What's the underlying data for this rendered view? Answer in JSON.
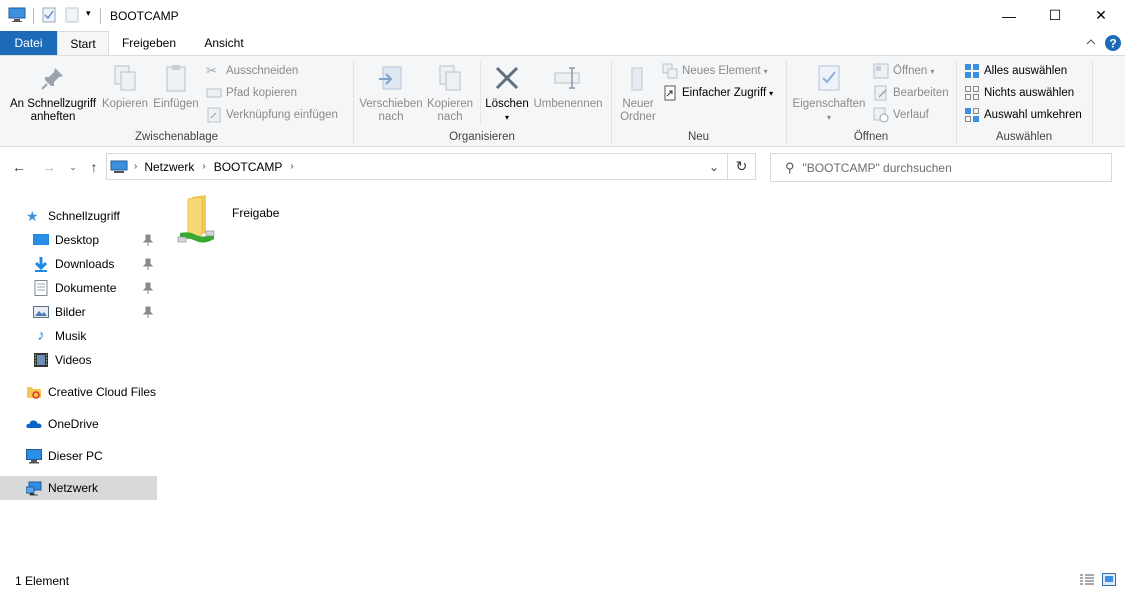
{
  "window": {
    "title": "BOOTCAMP",
    "minimize_glyph": "—",
    "maximize_glyph": "☐",
    "close_glyph": "✕"
  },
  "tabs": [
    {
      "label": "Datei"
    },
    {
      "label": "Start"
    },
    {
      "label": "Freigeben"
    },
    {
      "label": "Ansicht"
    }
  ],
  "ribbon": {
    "clipboard": {
      "label": "Zwischenablage",
      "pin_quick_line1": "An Schnellzugriff",
      "pin_quick_line2": "anheften",
      "copy": "Kopieren",
      "paste": "Einfügen",
      "cut": "Ausschneiden",
      "copy_path": "Pfad kopieren",
      "paste_shortcut": "Verknüpfung einfügen"
    },
    "organize": {
      "label": "Organisieren",
      "move_line1": "Verschieben",
      "move_line2": "nach",
      "copy_line1": "Kopieren",
      "copy_line2": "nach",
      "delete": "Löschen",
      "rename": "Umbenennen"
    },
    "new": {
      "label": "Neu",
      "new_folder_line1": "Neuer",
      "new_folder_line2": "Ordner",
      "new_item": "Neues Element",
      "easy_access": "Einfacher Zugriff"
    },
    "open": {
      "label": "Öffnen",
      "properties": "Eigenschaften",
      "open": "Öffnen",
      "edit": "Bearbeiten",
      "history": "Verlauf"
    },
    "select": {
      "label": "Auswählen",
      "select_all": "Alles auswählen",
      "select_none": "Nichts auswählen",
      "invert": "Auswahl umkehren"
    }
  },
  "address": {
    "crumbs": [
      "Netzwerk",
      "BOOTCAMP"
    ],
    "search_placeholder": "\"BOOTCAMP\" durchsuchen"
  },
  "nav": {
    "quick_access": "Schnellzugriff",
    "items": [
      {
        "label": "Desktop",
        "icon": "desktop-icon",
        "pinned": true
      },
      {
        "label": "Downloads",
        "icon": "downloads-icon",
        "pinned": true
      },
      {
        "label": "Dokumente",
        "icon": "documents-icon",
        "pinned": true
      },
      {
        "label": "Bilder",
        "icon": "pictures-icon",
        "pinned": true
      },
      {
        "label": "Musik",
        "icon": "music-icon",
        "pinned": false
      },
      {
        "label": "Videos",
        "icon": "videos-icon",
        "pinned": false
      }
    ],
    "creative_cloud": "Creative Cloud Files",
    "onedrive": "OneDrive",
    "this_pc": "Dieser PC",
    "network": "Netzwerk"
  },
  "content": {
    "items": [
      {
        "name": "Freigabe",
        "icon": "shared-folder-icon"
      }
    ]
  },
  "status": {
    "count": "1 Element"
  },
  "colors": {
    "accent": "#1c6ab8",
    "selected_bg": "#d9d9d9",
    "ribbon_bg": "#f5f6f7"
  }
}
